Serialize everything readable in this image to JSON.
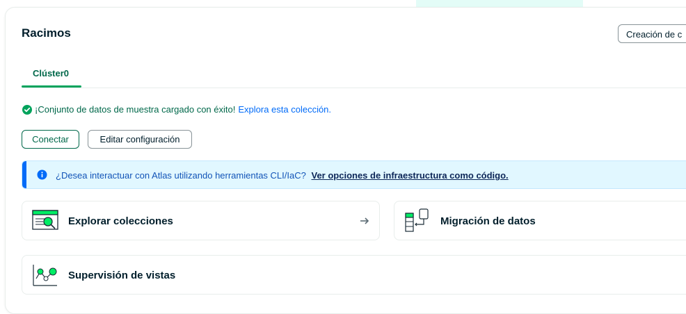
{
  "header": {
    "title": "Racimos",
    "create_button": "Creación de c"
  },
  "tabs": [
    {
      "label": "Clúster0",
      "active": true
    }
  ],
  "status": {
    "success_text": "¡Conjunto de datos de muestra cargado con éxito!",
    "success_link": "Explora esta colección."
  },
  "actions": {
    "connect": "Conectar",
    "edit": "Editar configuración"
  },
  "banner": {
    "text": "¿Desea interactuar con Atlas utilizando herramientas CLI/IaC?",
    "link": "Ver opciones de infraestructura como código."
  },
  "cards": {
    "explore": "Explorar colecciones",
    "migrate": "Migración de datos",
    "monitor": "Supervisión de vistas"
  },
  "colors": {
    "brand_green": "#00684a",
    "accent_green": "#00ed64",
    "link_blue": "#016bf8",
    "info_bg": "#e1f7ff"
  }
}
